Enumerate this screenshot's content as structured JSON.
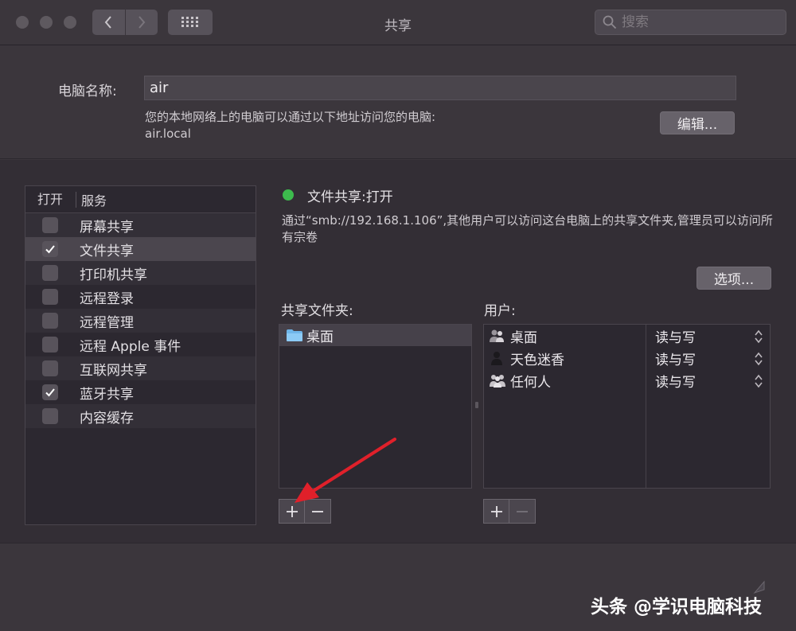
{
  "window": {
    "title": "共享",
    "search_placeholder": "搜索"
  },
  "computer": {
    "name_label": "电脑名称:",
    "name_value": "air",
    "address_desc": "您的本地网络上的电脑可以通过以下地址访问您的电脑:",
    "address": "air.local",
    "edit_button": "编辑..."
  },
  "services": {
    "header_on": "打开",
    "header_service": "服务",
    "items": [
      {
        "label": "屏幕共享",
        "checked": false
      },
      {
        "label": "文件共享",
        "checked": true
      },
      {
        "label": "打印机共享",
        "checked": false
      },
      {
        "label": "远程登录",
        "checked": false
      },
      {
        "label": "远程管理",
        "checked": false
      },
      {
        "label": "远程 Apple 事件",
        "checked": false
      },
      {
        "label": "互联网共享",
        "checked": false
      },
      {
        "label": "蓝牙共享",
        "checked": true
      },
      {
        "label": "内容缓存",
        "checked": false
      }
    ]
  },
  "detail": {
    "status": "文件共享:打开",
    "status_color": "#3dbb4d",
    "description": "通过“smb://192.168.1.106”,其他用户可以访问这台电脑上的共享文件夹,管理员可以访问所有宗卷",
    "options_button": "选项...",
    "folders_label": "共享文件夹:",
    "users_label": "用户:",
    "folders": [
      "桌面"
    ],
    "users": [
      {
        "name": "桌面",
        "icon": "group-user-icon",
        "permission": "读与写"
      },
      {
        "name": "天色迷香",
        "icon": "single-user-icon",
        "permission": "读与写"
      },
      {
        "name": "任何人",
        "icon": "everyone-icon",
        "permission": "读与写"
      }
    ],
    "add_symbol": "+",
    "remove_symbol": "−"
  },
  "watermark": "头条 @学识电脑科技",
  "annotation_color": "#e0202a"
}
